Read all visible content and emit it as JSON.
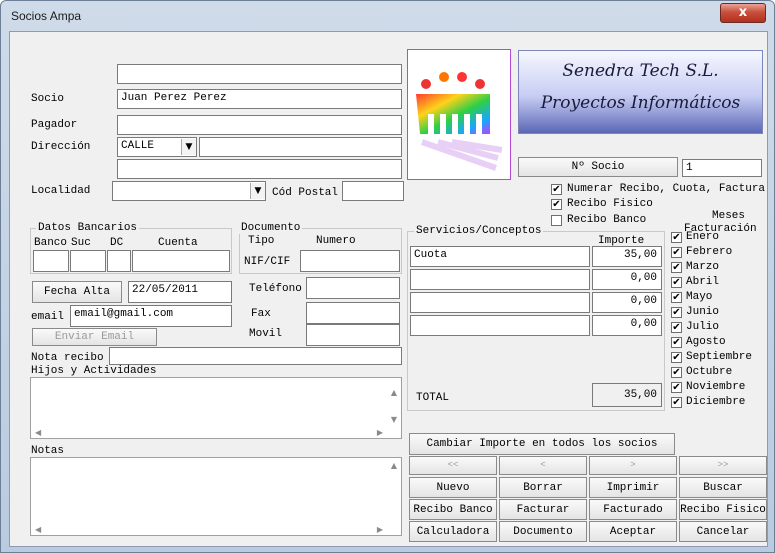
{
  "window": {
    "title": "Socios Ampa",
    "close_glyph": "x"
  },
  "labels": {
    "socio": "Socio",
    "pagador": "Pagador",
    "direccion": "Dirección",
    "localidad": "Localidad",
    "cod_postal": "Cód Postal",
    "datos_bancarios": "Datos Bancarios",
    "banco": "Banco",
    "suc": "Suc",
    "dc": "DC",
    "cuenta": "Cuenta",
    "documento": "Documento",
    "tipo": "Tipo",
    "numero": "Numero",
    "nif_cif": "NIF/CIF",
    "telefono": "Teléfono",
    "fax": "Fax",
    "movil": "Movil",
    "email": "email",
    "nota_recibo": "Nota recibo",
    "hijos": "Hijos y Actividades",
    "notas": "Notas",
    "servicios": "Servicios/Conceptos",
    "importe": "Importe",
    "total": "TOTAL",
    "meses": "Meses",
    "facturacion": "Facturación"
  },
  "fields": {
    "top_blank": "",
    "socio": "Juan Perez Perez",
    "pagador": "",
    "via": "CALLE",
    "direccion": "",
    "direccion2": "",
    "localidad": "",
    "cod_postal": "",
    "fecha_alta": "22/05/2011",
    "email": "email@gmail.com",
    "num_socio": "1",
    "nota_recibo": ""
  },
  "brand": {
    "line1": "Senedra Tech S.L.",
    "line2": "Proyectos Informáticos",
    "logo_icon": "people-logo-icon"
  },
  "buttons": {
    "num_socio": "Nº Socio",
    "fecha_alta": "Fecha Alta",
    "enviar_email": "Enviar Email",
    "cambiar_importe": "Cambiar Importe en todos los socios",
    "first": "<<",
    "prev": "<",
    "next": ">",
    "last": ">>",
    "nuevo": "Nuevo",
    "borrar": "Borrar",
    "imprimir": "Imprimir",
    "buscar": "Buscar",
    "recibo_banco": "Recibo Banco",
    "facturar": "Facturar",
    "facturado": "Facturado",
    "recibo_fisico": "Recibo Fisico",
    "calculadora": "Calculadora",
    "documento": "Documento",
    "aceptar": "Aceptar",
    "cancelar": "Cancelar"
  },
  "options": [
    {
      "label": "Numerar Recibo, Cuota, Factura",
      "checked": true
    },
    {
      "label": "Recibo Fisico",
      "checked": true
    },
    {
      "label": "Recibo Banco",
      "checked": false
    }
  ],
  "servicios": [
    {
      "concepto": "Cuota",
      "importe": "35,00"
    },
    {
      "concepto": "",
      "importe": "0,00"
    },
    {
      "concepto": "",
      "importe": "0,00"
    },
    {
      "concepto": "",
      "importe": "0,00"
    }
  ],
  "total": "35,00",
  "meses": [
    {
      "label": "Enero",
      "checked": true
    },
    {
      "label": "Febrero",
      "checked": true
    },
    {
      "label": "Marzo",
      "checked": true
    },
    {
      "label": "Abril",
      "checked": true
    },
    {
      "label": "Mayo",
      "checked": true
    },
    {
      "label": "Junio",
      "checked": true
    },
    {
      "label": "Julio",
      "checked": true
    },
    {
      "label": "Agosto",
      "checked": true
    },
    {
      "label": "Septiembre",
      "checked": true
    },
    {
      "label": "Octubre",
      "checked": true
    },
    {
      "label": "Noviembre",
      "checked": true
    },
    {
      "label": "Diciembre",
      "checked": true
    }
  ],
  "check_glyph": "✔",
  "arrows": {
    "up": "▲",
    "down": "▼",
    "left": "◀",
    "right": "▶",
    "combo": "▼"
  }
}
